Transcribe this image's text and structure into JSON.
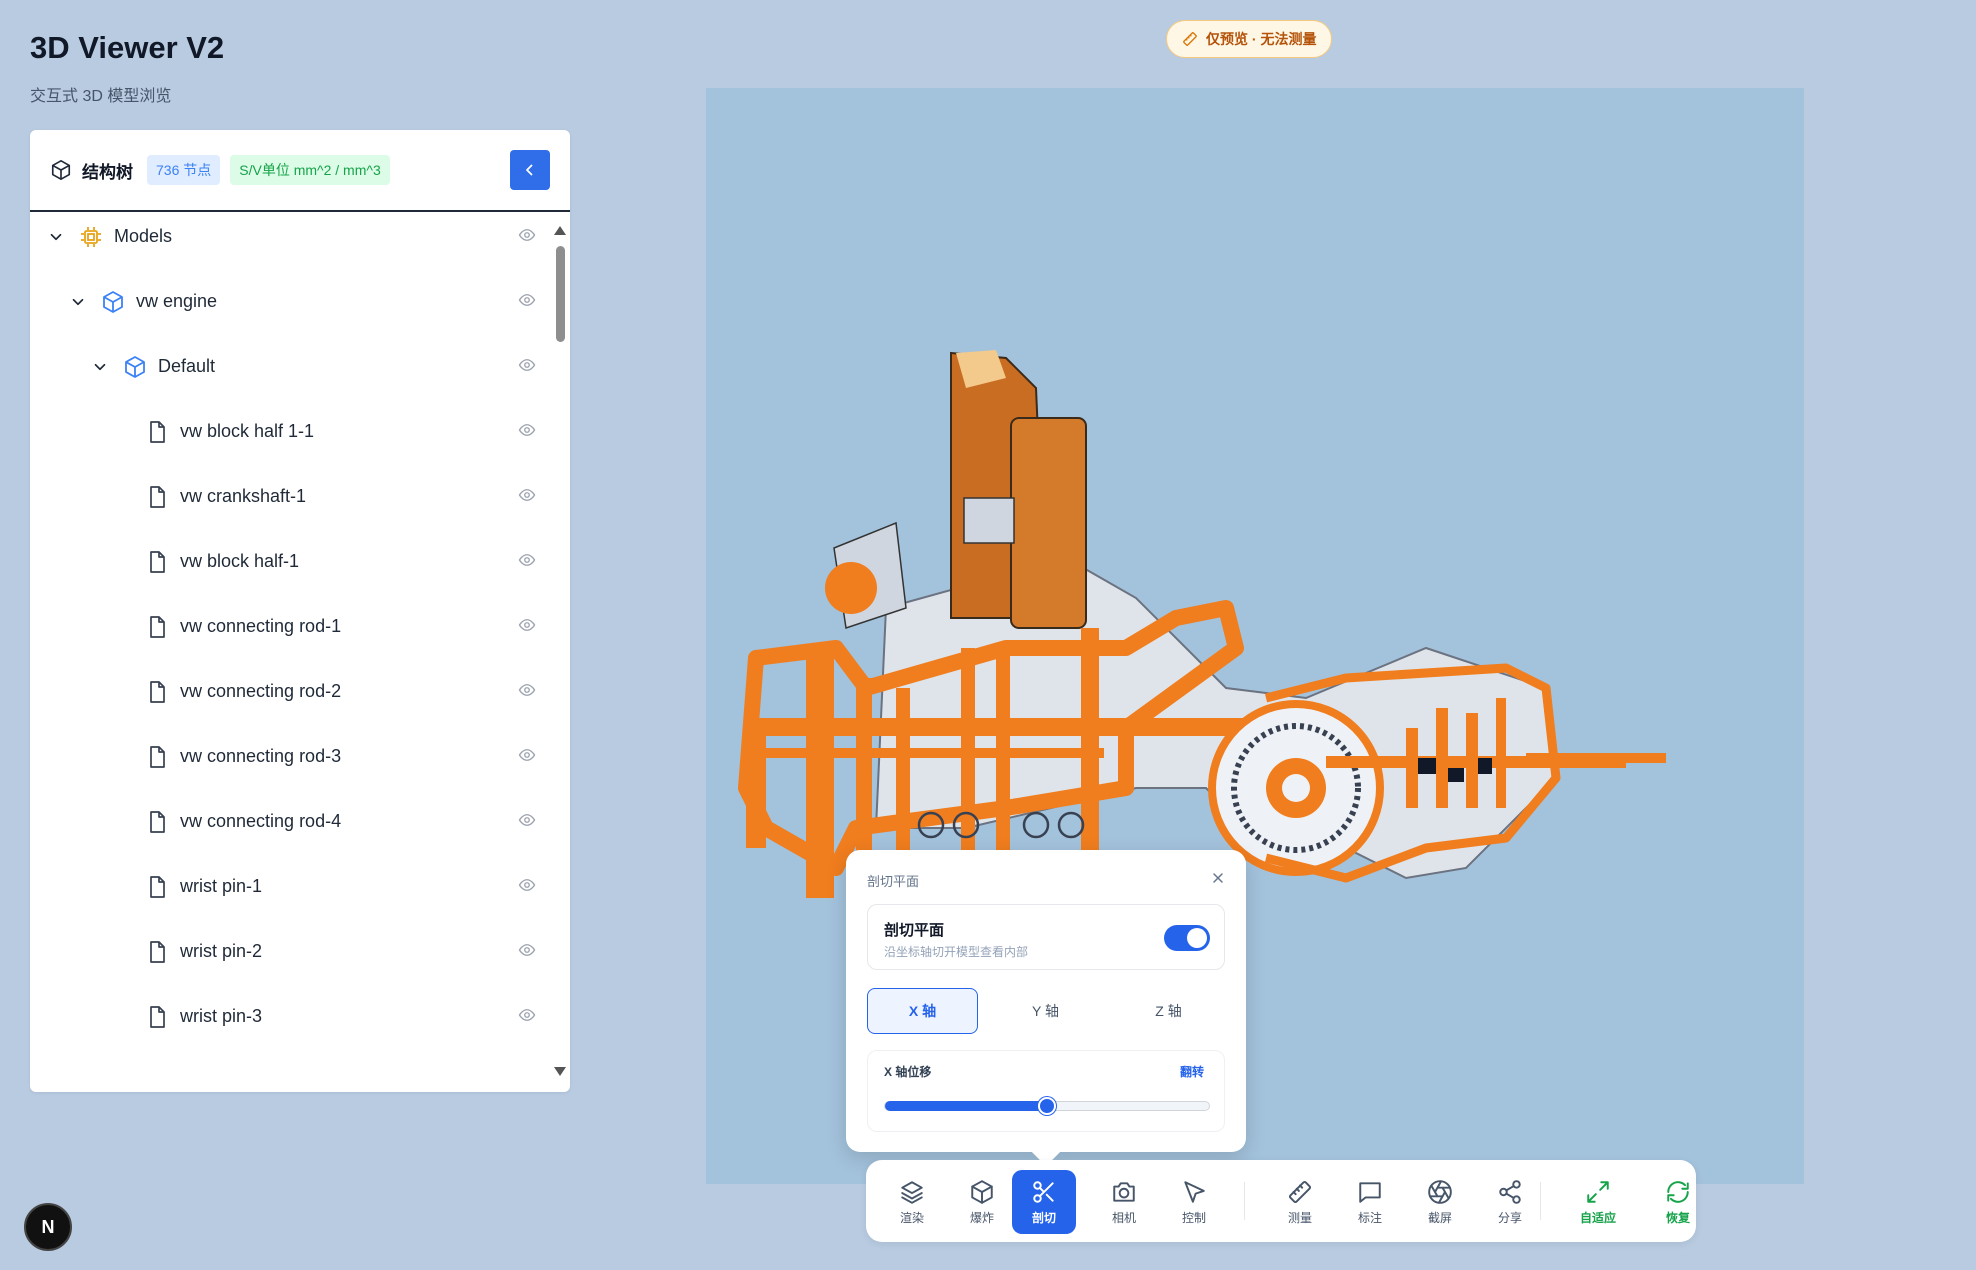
{
  "app": {
    "title": "3D Viewer V2",
    "subtitle": "交互式 3D 模型浏览"
  },
  "preview_chip": {
    "label": "仅预览 · 无法测量",
    "icon": "ruler-icon"
  },
  "tree": {
    "title": "结构树",
    "node_count": "736 节点",
    "units": "S/V单位 mm^2 / mm^3",
    "collapse_icon": "chevron-left-icon",
    "items": [
      {
        "label": "Models",
        "level": 0,
        "icon": "chip-icon",
        "expandable": true
      },
      {
        "label": "vw engine",
        "level": 1,
        "icon": "cube-icon",
        "expandable": true
      },
      {
        "label": "Default",
        "level": 2,
        "icon": "cube-icon",
        "expandable": true
      },
      {
        "label": "vw block half 1-1",
        "level": 3,
        "icon": "file-icon",
        "expandable": false
      },
      {
        "label": "vw crankshaft-1",
        "level": 3,
        "icon": "file-icon",
        "expandable": false
      },
      {
        "label": "vw block half-1",
        "level": 3,
        "icon": "file-icon",
        "expandable": false
      },
      {
        "label": "vw connecting rod-1",
        "level": 3,
        "icon": "file-icon",
        "expandable": false
      },
      {
        "label": "vw connecting rod-2",
        "level": 3,
        "icon": "file-icon",
        "expandable": false
      },
      {
        "label": "vw connecting rod-3",
        "level": 3,
        "icon": "file-icon",
        "expandable": false
      },
      {
        "label": "vw connecting rod-4",
        "level": 3,
        "icon": "file-icon",
        "expandable": false
      },
      {
        "label": "wrist pin-1",
        "level": 3,
        "icon": "file-icon",
        "expandable": false
      },
      {
        "label": "wrist pin-2",
        "level": 3,
        "icon": "file-icon",
        "expandable": false
      },
      {
        "label": "wrist pin-3",
        "level": 3,
        "icon": "file-icon",
        "expandable": false
      }
    ]
  },
  "section_popup": {
    "title": "剖切平面",
    "toggle_title": "剖切平面",
    "toggle_subtitle": "沿坐标轴切开模型查看内部",
    "toggle_on": true,
    "axes": [
      "X 轴",
      "Y 轴",
      "Z 轴"
    ],
    "active_axis": "X 轴",
    "slider_label": "X 轴位移",
    "flip_label": "翻转",
    "slider_value": 0.5
  },
  "toolbar": {
    "buttons": [
      {
        "label": "渲染",
        "icon": "layers-icon"
      },
      {
        "label": "爆炸",
        "icon": "cube-icon"
      },
      {
        "label": "剖切",
        "icon": "scissors-icon",
        "active": true
      },
      {
        "label": "相机",
        "icon": "camera-icon"
      },
      {
        "label": "控制",
        "icon": "cursor-icon"
      },
      {
        "label": "测量",
        "icon": "ruler-icon"
      },
      {
        "label": "标注",
        "icon": "comment-icon"
      },
      {
        "label": "截屏",
        "icon": "aperture-icon"
      },
      {
        "label": "分享",
        "icon": "share-icon"
      },
      {
        "label": "自适应",
        "icon": "expand-icon",
        "green": true
      },
      {
        "label": "恢复",
        "icon": "refresh-icon",
        "green": true
      }
    ]
  },
  "next_badge": "N",
  "colors": {
    "accent": "#2563eb",
    "section_orange": "#f07d1e",
    "viewport_bg": "#a3c2dc",
    "page_bg": "#b8cbe1"
  }
}
